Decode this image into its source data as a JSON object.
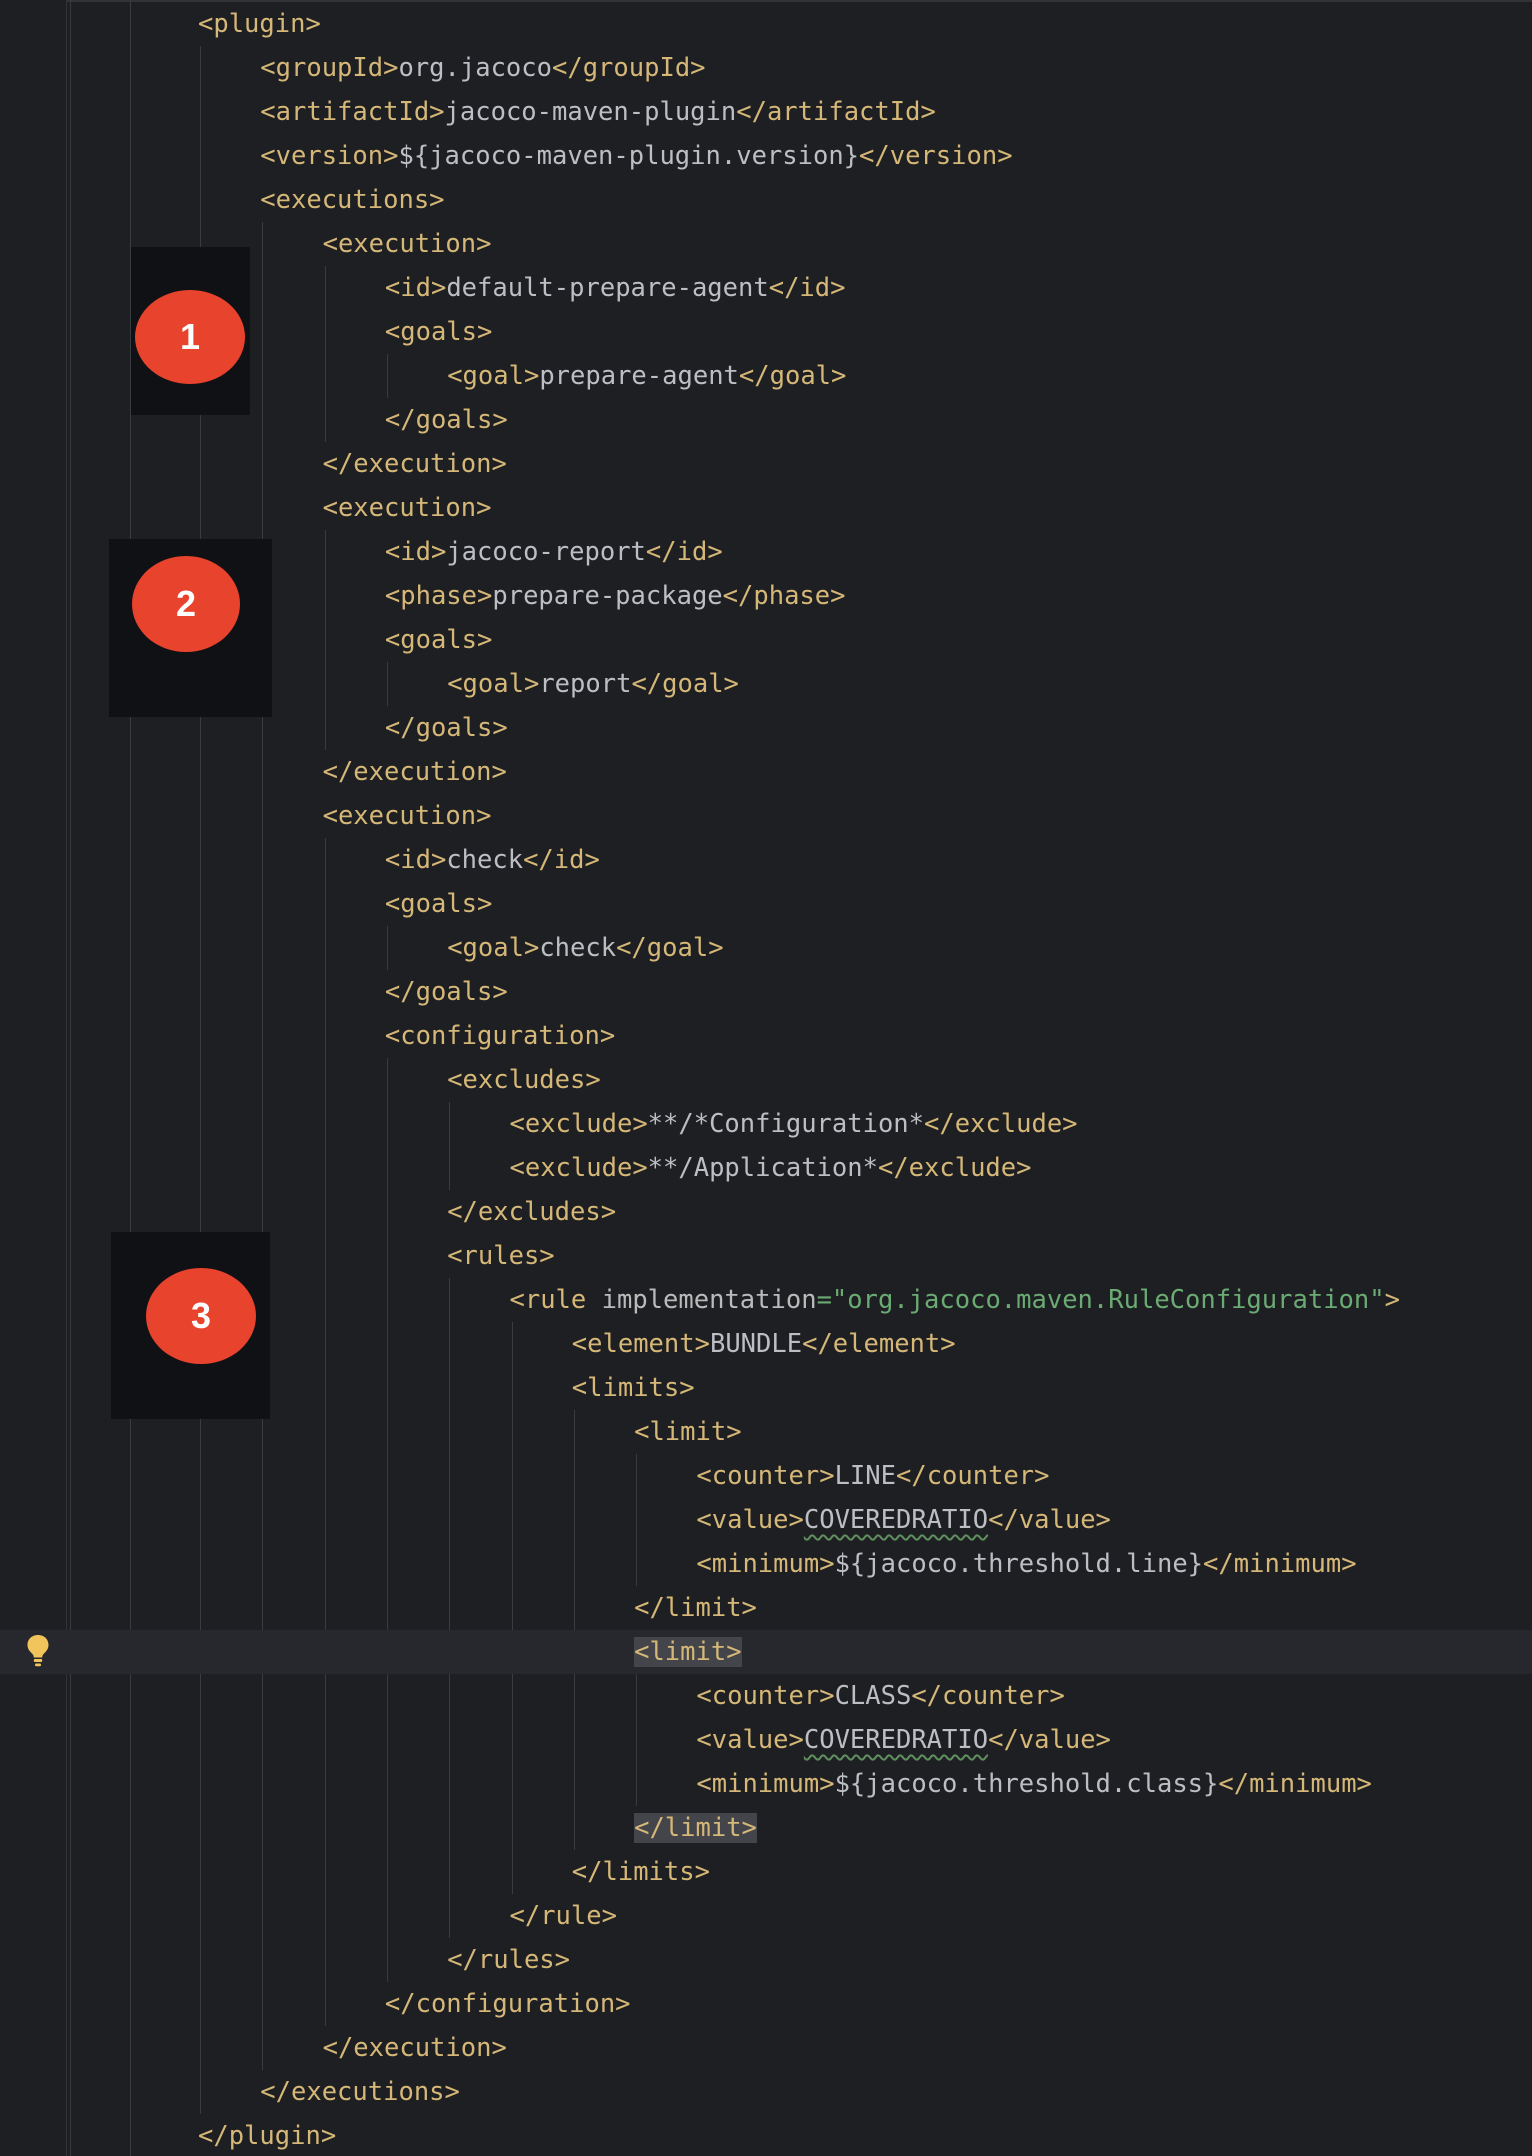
{
  "lines": [
    {
      "indent": 0,
      "parts": [
        {
          "t": "tag",
          "v": "<plugin>"
        }
      ]
    },
    {
      "indent": 1,
      "parts": [
        {
          "t": "tag",
          "v": "<groupId>"
        },
        {
          "t": "txt",
          "v": "org.jacoco"
        },
        {
          "t": "tag",
          "v": "</groupId>"
        }
      ]
    },
    {
      "indent": 1,
      "parts": [
        {
          "t": "tag",
          "v": "<artifactId>"
        },
        {
          "t": "txt",
          "v": "jacoco-maven-plugin"
        },
        {
          "t": "tag",
          "v": "</artifactId>"
        }
      ]
    },
    {
      "indent": 1,
      "parts": [
        {
          "t": "tag",
          "v": "<version>"
        },
        {
          "t": "txt",
          "v": "${jacoco-maven-plugin.version}"
        },
        {
          "t": "tag",
          "v": "</version>"
        }
      ]
    },
    {
      "indent": 1,
      "parts": [
        {
          "t": "tag",
          "v": "<executions>"
        }
      ]
    },
    {
      "indent": 2,
      "parts": [
        {
          "t": "tag",
          "v": "<execution>"
        }
      ]
    },
    {
      "indent": 3,
      "parts": [
        {
          "t": "tag",
          "v": "<id>"
        },
        {
          "t": "txt",
          "v": "default-prepare-agent"
        },
        {
          "t": "tag",
          "v": "</id>"
        }
      ]
    },
    {
      "indent": 3,
      "parts": [
        {
          "t": "tag",
          "v": "<goals>"
        }
      ]
    },
    {
      "indent": 4,
      "parts": [
        {
          "t": "tag",
          "v": "<goal>"
        },
        {
          "t": "txt",
          "v": "prepare-agent"
        },
        {
          "t": "tag",
          "v": "</goal>"
        }
      ]
    },
    {
      "indent": 3,
      "parts": [
        {
          "t": "tag",
          "v": "</goals>"
        }
      ]
    },
    {
      "indent": 2,
      "parts": [
        {
          "t": "tag",
          "v": "</execution>"
        }
      ]
    },
    {
      "indent": 2,
      "parts": [
        {
          "t": "tag",
          "v": "<execution>"
        }
      ]
    },
    {
      "indent": 3,
      "parts": [
        {
          "t": "tag",
          "v": "<id>"
        },
        {
          "t": "txt",
          "v": "jacoco-report"
        },
        {
          "t": "tag",
          "v": "</id>"
        }
      ]
    },
    {
      "indent": 3,
      "parts": [
        {
          "t": "tag",
          "v": "<phase>"
        },
        {
          "t": "txt",
          "v": "prepare-package"
        },
        {
          "t": "tag",
          "v": "</phase>"
        }
      ]
    },
    {
      "indent": 3,
      "parts": [
        {
          "t": "tag",
          "v": "<goals>"
        }
      ]
    },
    {
      "indent": 4,
      "parts": [
        {
          "t": "tag",
          "v": "<goal>"
        },
        {
          "t": "txt",
          "v": "report"
        },
        {
          "t": "tag",
          "v": "</goal>"
        }
      ]
    },
    {
      "indent": 3,
      "parts": [
        {
          "t": "tag",
          "v": "</goals>"
        }
      ]
    },
    {
      "indent": 2,
      "parts": [
        {
          "t": "tag",
          "v": "</execution>"
        }
      ]
    },
    {
      "indent": 2,
      "parts": [
        {
          "t": "tag",
          "v": "<execution>"
        }
      ]
    },
    {
      "indent": 3,
      "parts": [
        {
          "t": "tag",
          "v": "<id>"
        },
        {
          "t": "txt",
          "v": "check"
        },
        {
          "t": "tag",
          "v": "</id>"
        }
      ]
    },
    {
      "indent": 3,
      "parts": [
        {
          "t": "tag",
          "v": "<goals>"
        }
      ]
    },
    {
      "indent": 4,
      "parts": [
        {
          "t": "tag",
          "v": "<goal>"
        },
        {
          "t": "txt",
          "v": "check"
        },
        {
          "t": "tag",
          "v": "</goal>"
        }
      ]
    },
    {
      "indent": 3,
      "parts": [
        {
          "t": "tag",
          "v": "</goals>"
        }
      ]
    },
    {
      "indent": 3,
      "parts": [
        {
          "t": "tag",
          "v": "<configuration>"
        }
      ]
    },
    {
      "indent": 4,
      "parts": [
        {
          "t": "tag",
          "v": "<excludes>"
        }
      ]
    },
    {
      "indent": 5,
      "parts": [
        {
          "t": "tag",
          "v": "<exclude>"
        },
        {
          "t": "txt",
          "v": "**/*Configuration*"
        },
        {
          "t": "tag",
          "v": "</exclude>"
        }
      ]
    },
    {
      "indent": 5,
      "parts": [
        {
          "t": "tag",
          "v": "<exclude>"
        },
        {
          "t": "txt",
          "v": "**/Application*"
        },
        {
          "t": "tag",
          "v": "</exclude>"
        }
      ]
    },
    {
      "indent": 4,
      "parts": [
        {
          "t": "tag",
          "v": "</excludes>"
        }
      ]
    },
    {
      "indent": 4,
      "parts": [
        {
          "t": "tag",
          "v": "<rules>"
        }
      ]
    },
    {
      "indent": 5,
      "parts": [
        {
          "t": "tag",
          "v": "<rule "
        },
        {
          "t": "attr",
          "v": "implementation"
        },
        {
          "t": "str",
          "v": "=\"org.jacoco.maven.RuleConfiguration\""
        },
        {
          "t": "tag",
          "v": ">"
        }
      ]
    },
    {
      "indent": 6,
      "parts": [
        {
          "t": "tag",
          "v": "<element>"
        },
        {
          "t": "txt",
          "v": "BUNDLE"
        },
        {
          "t": "tag",
          "v": "</element>"
        }
      ]
    },
    {
      "indent": 6,
      "parts": [
        {
          "t": "tag",
          "v": "<limits>"
        }
      ]
    },
    {
      "indent": 7,
      "parts": [
        {
          "t": "tag",
          "v": "<limit>"
        }
      ]
    },
    {
      "indent": 8,
      "parts": [
        {
          "t": "tag",
          "v": "<counter>"
        },
        {
          "t": "txt",
          "v": "LINE"
        },
        {
          "t": "tag",
          "v": "</counter>"
        }
      ]
    },
    {
      "indent": 8,
      "parts": [
        {
          "t": "tag",
          "v": "<value>"
        },
        {
          "t": "txt",
          "v": "COVEREDRATIO",
          "sq": true
        },
        {
          "t": "tag",
          "v": "</value>"
        }
      ]
    },
    {
      "indent": 8,
      "parts": [
        {
          "t": "tag",
          "v": "<minimum>"
        },
        {
          "t": "txt",
          "v": "${jacoco.threshold.line}"
        },
        {
          "t": "tag",
          "v": "</minimum>"
        }
      ]
    },
    {
      "indent": 7,
      "parts": [
        {
          "t": "tag",
          "v": "</limit>"
        }
      ]
    },
    {
      "indent": 7,
      "current": true,
      "parts": [
        {
          "t": "tag",
          "v": "<limit>",
          "hl": true
        }
      ]
    },
    {
      "indent": 8,
      "parts": [
        {
          "t": "tag",
          "v": "<counter>"
        },
        {
          "t": "txt",
          "v": "CLASS"
        },
        {
          "t": "tag",
          "v": "</counter>"
        }
      ]
    },
    {
      "indent": 8,
      "parts": [
        {
          "t": "tag",
          "v": "<value>"
        },
        {
          "t": "txt",
          "v": "COVEREDRATIO",
          "sq": true
        },
        {
          "t": "tag",
          "v": "</value>"
        }
      ]
    },
    {
      "indent": 8,
      "parts": [
        {
          "t": "tag",
          "v": "<minimum>"
        },
        {
          "t": "txt",
          "v": "${jacoco.threshold.class}"
        },
        {
          "t": "tag",
          "v": "</minimum>"
        }
      ]
    },
    {
      "indent": 7,
      "parts": [
        {
          "t": "tag",
          "v": "</limit>",
          "hl": true
        }
      ]
    },
    {
      "indent": 6,
      "parts": [
        {
          "t": "tag",
          "v": "</limits>"
        }
      ]
    },
    {
      "indent": 5,
      "parts": [
        {
          "t": "tag",
          "v": "</rule>"
        }
      ]
    },
    {
      "indent": 4,
      "parts": [
        {
          "t": "tag",
          "v": "</rules>"
        }
      ]
    },
    {
      "indent": 3,
      "parts": [
        {
          "t": "tag",
          "v": "</configuration>"
        }
      ]
    },
    {
      "indent": 2,
      "parts": [
        {
          "t": "tag",
          "v": "</execution>"
        }
      ]
    },
    {
      "indent": 1,
      "parts": [
        {
          "t": "tag",
          "v": "</executions>"
        }
      ]
    },
    {
      "indent": 0,
      "parts": [
        {
          "t": "tag",
          "v": "</plugin>"
        }
      ]
    }
  ],
  "markers": [
    "1",
    "2",
    "3"
  ],
  "icons": {
    "intention": "lightbulb-icon"
  },
  "colors": {
    "background": "#1e1f22",
    "tag": "#d5b778",
    "text": "#bcbec4",
    "attr": "#bababa",
    "string": "#6aab73",
    "marker": "#e8432d",
    "bulb": "#f2c55c"
  }
}
